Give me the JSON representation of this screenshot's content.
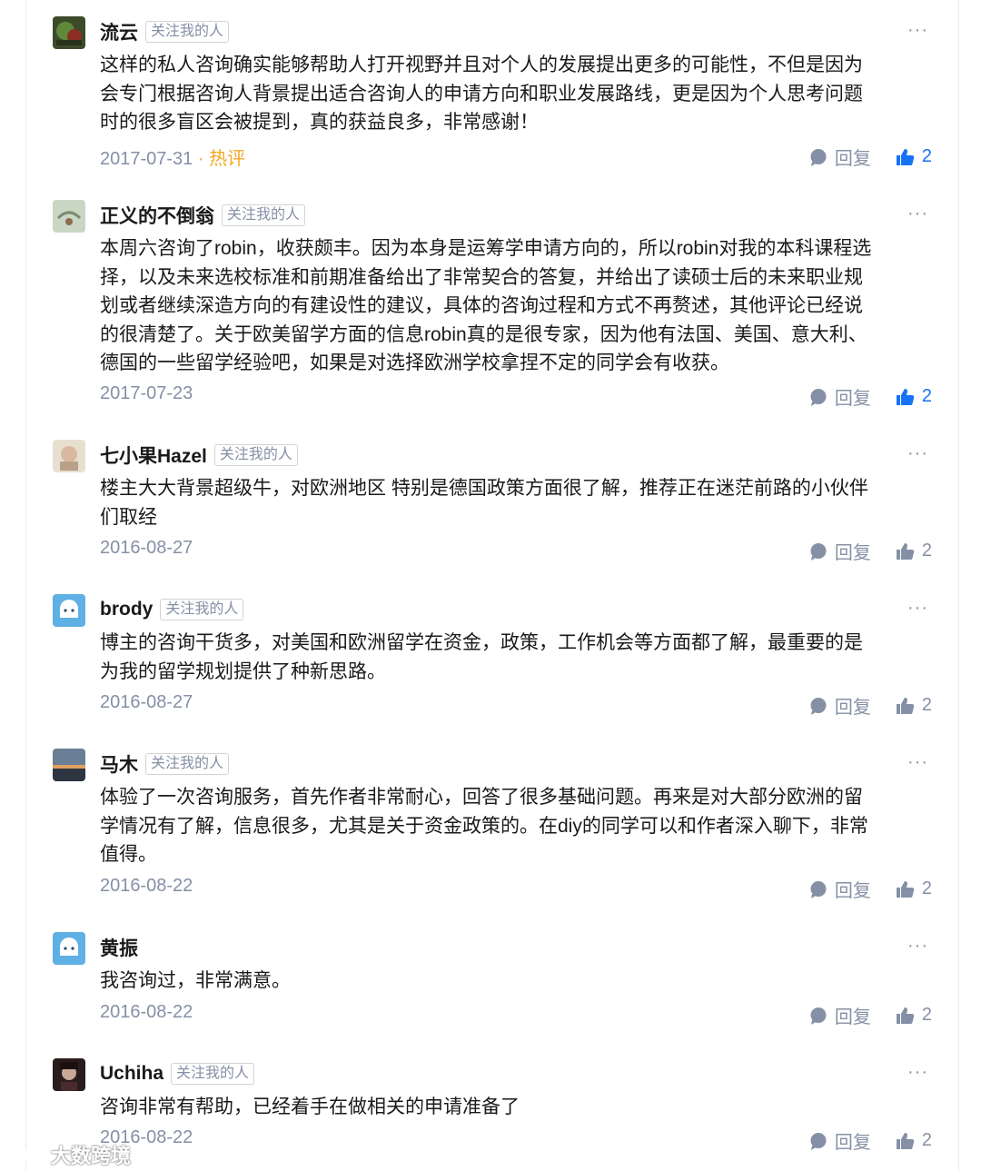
{
  "comments": [
    {
      "author": "流云",
      "badge": "关注我的人",
      "more": "···",
      "text": "这样的私人咨询确实能够帮助人打开视野并且对个人的发展提出更多的可能性，不但是因为\n会专门根据咨询人背景提出适合咨询人的申请方向和职业发展路线，更是因为个人思考问题\n时的很多盲区会被提到，真的获益良多，非常感谢！",
      "date": "2017-07-31",
      "hot": " · 热评",
      "reply": "回复",
      "likes": "2",
      "liked": true,
      "avatar": "green-leaf"
    },
    {
      "author": "正义的不倒翁",
      "badge": "关注我的人",
      "more": "···",
      "text": "本周六咨询了robin，收获颇丰。因为本身是运筹学申请方向的，所以robin对我的本科课程选\n择，以及未来选校标准和前期准备给出了非常契合的答复，并给出了读硕士后的未来职业规\n划或者继续深造方向的有建设性的建议，具体的咨询过程和方式不再赘述，其他评论已经说\n的很清楚了。关于欧美留学方面的信息robin真的是很专家，因为他有法国、美国、意大利、\n德国的一些留学经验吧，如果是对选择欧洲学校拿捏不定的同学会有收获。",
      "date": "2017-07-23",
      "hot": "",
      "reply": "回复",
      "likes": "2",
      "liked": true,
      "avatar": "pale-sky"
    },
    {
      "author": "七小果Hazel",
      "badge": "关注我的人",
      "more": "···",
      "text": "楼主大大背景超级牛，对欧洲地区 特别是德国政策方面很了解，推荐正在迷茫前路的小伙伴\n们取经",
      "date": "2016-08-27",
      "hot": "",
      "reply": "回复",
      "likes": "2",
      "liked": false,
      "avatar": "beige-photo"
    },
    {
      "author": "brody",
      "badge": "关注我的人",
      "more": "···",
      "text": "博主的咨询干货多，对美国和欧洲留学在资金，政策，工作机会等方面都了解，最重要的是\n为我的留学规划提供了种新思路。",
      "date": "2016-08-27",
      "hot": "",
      "reply": "回复",
      "likes": "2",
      "liked": false,
      "avatar": "default-blue"
    },
    {
      "author": "马木",
      "badge": "关注我的人",
      "more": "···",
      "text": "体验了一次咨询服务，首先作者非常耐心，回答了很多基础问题。再来是对大部分欧洲的留\n学情况有了解，信息很多，尤其是关于资金政策的。在diy的同学可以和作者深入聊下，非常\n值得。",
      "date": "2016-08-22",
      "hot": "",
      "reply": "回复",
      "likes": "2",
      "liked": false,
      "avatar": "sunset"
    },
    {
      "author": "黄振",
      "badge": "",
      "more": "···",
      "text": "我咨询过，非常满意。",
      "date": "2016-08-22",
      "hot": "",
      "reply": "回复",
      "likes": "2",
      "liked": false,
      "avatar": "default-blue"
    },
    {
      "author": "Uchiha",
      "badge": "关注我的人",
      "more": "···",
      "text": "咨询非常有帮助，已经着手在做相关的申请准备了",
      "date": "2016-08-22",
      "hot": "",
      "reply": "回复",
      "likes": "2",
      "liked": false,
      "avatar": "dark-portrait"
    }
  ],
  "watermark": "大数跨境",
  "colors": {
    "accent": "#1772f6",
    "meta": "#8590a6",
    "hot": "#f5a623"
  }
}
